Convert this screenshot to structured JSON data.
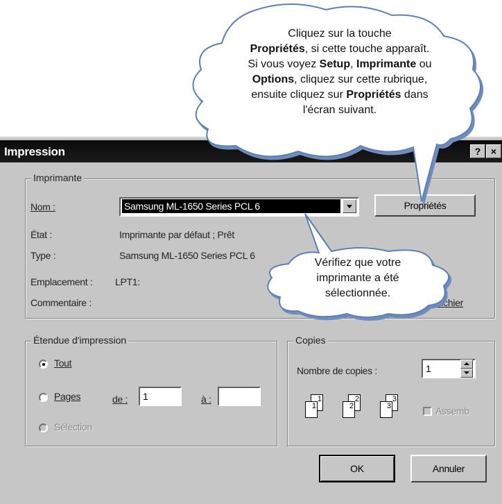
{
  "callout_top": {
    "line1": "Cliquez sur la touche",
    "line2_bold": "Propriétés",
    "line2_rest": ", si cette touche apparaît.",
    "line3_start": "Si vous voyez ",
    "line3_b1": "Setup",
    "line3_mid": ", ",
    "line3_b2": "Imprimante",
    "line3_end": " ou",
    "line4_bold": "Options",
    "line4_rest": ", cliquez sur cette rubrique,",
    "line5_start": "ensuite cliquez sur ",
    "line5_bold": "Propriétés",
    "line5_end": " dans",
    "line6": "l'écran suivant."
  },
  "callout_bottom": {
    "line1": "Vérifiez que votre",
    "line2": "imprimante a été",
    "line3": "sélectionnée."
  },
  "dialog": {
    "title": "Impression",
    "help_label": "?",
    "close_label": "×",
    "printer_group": {
      "legend": "Imprimante",
      "name_label": "Nom :",
      "name_value": "Samsung ML-1650 Series PCL 6",
      "properties_button": "Propriétés",
      "state_label": "État :",
      "state_value": "Imprimante par défaut ; Prêt",
      "type_label": "Type :",
      "type_value": "Samsung ML-1650 Series PCL 6",
      "location_label": "Emplacement :",
      "location_value": "LPT1:",
      "comment_label": "Commentaire :",
      "print_to_file_tail": "dans fichier"
    },
    "range_group": {
      "legend": "Étendue d'impression",
      "all_label": "Tout",
      "all_selected": true,
      "pages_label": "Pages",
      "from_label": "de :",
      "from_value": "1",
      "to_label": "à :",
      "to_value": "",
      "selection_label": "Sélection"
    },
    "copies_group": {
      "legend": "Copies",
      "count_label": "Nombre de copies :",
      "count_value": "1",
      "collate_label": "Assemb",
      "pages": [
        "1",
        "1",
        "2",
        "2",
        "3",
        "3"
      ]
    },
    "ok_button": "OK",
    "cancel_button": "Annuler"
  },
  "colors": {
    "dialog_bg": "#c6c6c6",
    "titlebar": "#111111",
    "callout_fill": "#ffffff",
    "callout_stroke": "#6a86b8"
  }
}
